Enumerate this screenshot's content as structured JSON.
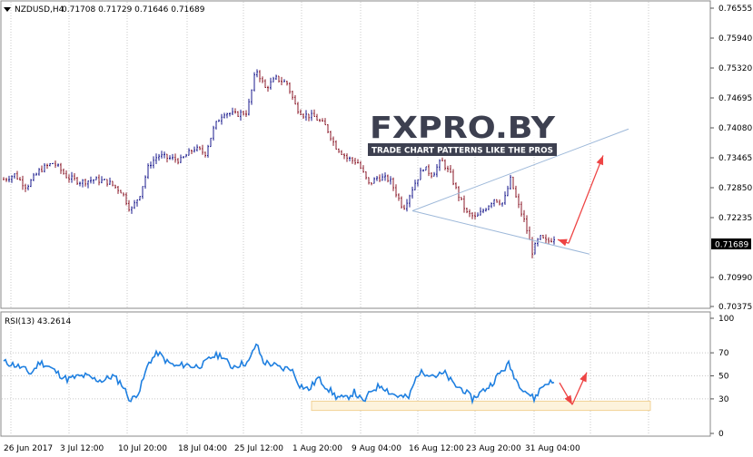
{
  "header": {
    "symbol_label": "NZDUSD,H4",
    "ohlc": "0.71708 0.71729 0.71646 0.71689"
  },
  "rsi": {
    "label": "RSI(13) 43.2614"
  },
  "watermark": {
    "brand": "FXPRO.BY",
    "tagline": "TRADE CHART PATTERNS LIKE THE PROS"
  },
  "colors": {
    "bull_candle": "#1a1a8c",
    "bear_candle": "#8b1a2a",
    "rsi_line": "#1e7fe0",
    "trendline": "#9db8d9",
    "forecast_arrow": "#ee4444",
    "highlight_box": "#f2d296",
    "grid": "#c8c8c8",
    "watermark_dark": "#3d4050",
    "watermark_red": "#ee1c25"
  },
  "chart_data": [
    {
      "type": "candlestick",
      "title": "NZDUSD,H4",
      "y_ticks": [
        "0.76555",
        "0.75940",
        "0.75320",
        "0.74695",
        "0.74080",
        "0.73465",
        "0.72850",
        "0.72235",
        "0.71689",
        "0.70990",
        "0.70375"
      ],
      "ylim": [
        0.70375,
        0.76555
      ],
      "x_ticks": [
        "26 Jun 2017",
        "3 Jul 12:00",
        "10 Jul 20:00",
        "18 Jul 04:00",
        "25 Jul 12:00",
        "1 Aug 20:00",
        "9 Aug 04:00",
        "16 Aug 12:00",
        "23 Aug 20:00",
        "31 Aug 04:00"
      ],
      "current_price": "0.71689",
      "approx_close_path": [
        [
          0,
          0.729
        ],
        [
          12,
          0.73
        ],
        [
          25,
          0.7275
        ],
        [
          40,
          0.731
        ],
        [
          55,
          0.7325
        ],
        [
          70,
          0.7295
        ],
        [
          85,
          0.7285
        ],
        [
          100,
          0.729
        ],
        [
          115,
          0.7285
        ],
        [
          130,
          0.7265
        ],
        [
          140,
          0.7225
        ],
        [
          150,
          0.726
        ],
        [
          160,
          0.732
        ],
        [
          170,
          0.734
        ],
        [
          180,
          0.7335
        ],
        [
          195,
          0.733
        ],
        [
          210,
          0.7355
        ],
        [
          222,
          0.7345
        ],
        [
          232,
          0.74
        ],
        [
          242,
          0.743
        ],
        [
          255,
          0.7425
        ],
        [
          268,
          0.743
        ],
        [
          278,
          0.752
        ],
        [
          288,
          0.748
        ],
        [
          300,
          0.75
        ],
        [
          312,
          0.749
        ],
        [
          322,
          0.744
        ],
        [
          330,
          0.7425
        ],
        [
          342,
          0.742
        ],
        [
          355,
          0.74
        ],
        [
          365,
          0.736
        ],
        [
          378,
          0.7335
        ],
        [
          390,
          0.7325
        ],
        [
          402,
          0.728
        ],
        [
          412,
          0.7295
        ],
        [
          425,
          0.729
        ],
        [
          440,
          0.723
        ],
        [
          452,
          0.728
        ],
        [
          462,
          0.7315
        ],
        [
          472,
          0.73
        ],
        [
          482,
          0.733
        ],
        [
          492,
          0.73
        ],
        [
          500,
          0.726
        ],
        [
          510,
          0.722
        ],
        [
          520,
          0.721
        ],
        [
          530,
          0.723
        ],
        [
          540,
          0.725
        ],
        [
          550,
          0.724
        ],
        [
          558,
          0.729
        ],
        [
          566,
          0.724
        ],
        [
          574,
          0.72
        ],
        [
          582,
          0.714
        ],
        [
          590,
          0.717
        ],
        [
          598,
          0.716
        ],
        [
          606,
          0.7169
        ]
      ],
      "trendline_upper": [
        [
          450,
          0.7225
        ],
        [
          688,
          0.7395
        ]
      ],
      "trendline_lower": [
        [
          450,
          0.7225
        ],
        [
          645,
          0.7135
        ]
      ],
      "forecast": {
        "from": [
          614,
          0.715
        ],
        "to": [
          660,
          0.734
        ]
      }
    },
    {
      "type": "line",
      "title": "RSI(13) 43.2614",
      "y_ticks": [
        "100",
        "70",
        "50",
        "30",
        "0"
      ],
      "ylim": [
        0,
        100
      ],
      "levels": [
        70,
        50,
        30
      ],
      "approx_path": [
        [
          0,
          62
        ],
        [
          10,
          60
        ],
        [
          20,
          57
        ],
        [
          30,
          52
        ],
        [
          40,
          62
        ],
        [
          50,
          58
        ],
        [
          60,
          52
        ],
        [
          70,
          47
        ],
        [
          80,
          49
        ],
        [
          90,
          50
        ],
        [
          100,
          47
        ],
        [
          110,
          46
        ],
        [
          120,
          50
        ],
        [
          130,
          43
        ],
        [
          140,
          28
        ],
        [
          150,
          38
        ],
        [
          160,
          62
        ],
        [
          170,
          70
        ],
        [
          180,
          62
        ],
        [
          190,
          58
        ],
        [
          200,
          60
        ],
        [
          210,
          58
        ],
        [
          220,
          60
        ],
        [
          230,
          67
        ],
        [
          240,
          68
        ],
        [
          250,
          58
        ],
        [
          260,
          60
        ],
        [
          270,
          62
        ],
        [
          278,
          78
        ],
        [
          286,
          62
        ],
        [
          296,
          60
        ],
        [
          306,
          56
        ],
        [
          316,
          57
        ],
        [
          326,
          42
        ],
        [
          336,
          38
        ],
        [
          346,
          48
        ],
        [
          356,
          40
        ],
        [
          366,
          32
        ],
        [
          376,
          30
        ],
        [
          386,
          36
        ],
        [
          396,
          27
        ],
        [
          406,
          38
        ],
        [
          416,
          42
        ],
        [
          426,
          35
        ],
        [
          436,
          32
        ],
        [
          446,
          31
        ],
        [
          456,
          52
        ],
        [
          466,
          53
        ],
        [
          476,
          50
        ],
        [
          486,
          52
        ],
        [
          496,
          42
        ],
        [
          506,
          38
        ],
        [
          516,
          30
        ],
        [
          526,
          36
        ],
        [
          536,
          42
        ],
        [
          546,
          52
        ],
        [
          556,
          60
        ],
        [
          566,
          44
        ],
        [
          576,
          36
        ],
        [
          584,
          30
        ],
        [
          592,
          40
        ],
        [
          600,
          45
        ],
        [
          606,
          43
        ]
      ],
      "oversold_zone": [
        20,
        28
      ],
      "forecast": [
        [
          604,
          44
        ],
        [
          626,
          25
        ],
        [
          642,
          53
        ]
      ]
    }
  ]
}
